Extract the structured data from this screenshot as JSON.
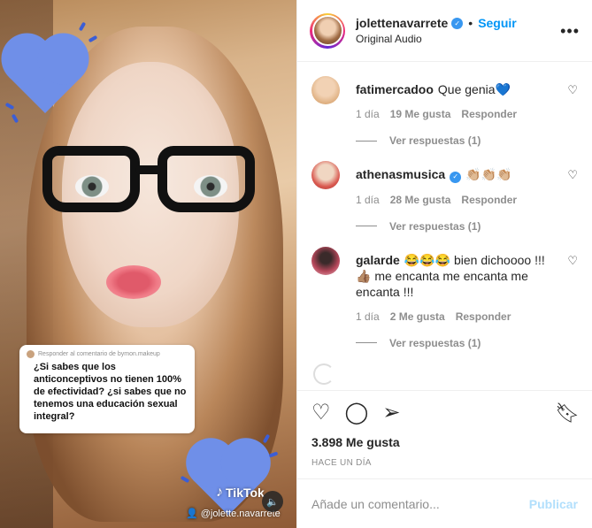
{
  "post": {
    "media": {
      "reply_card": {
        "meta": "Responder al comentario de bymon.makeup",
        "text": "¿Si sabes que los anticonceptivos no tienen 100% de efectividad? ¿si sabes que no tenemos una educación sexual integral?"
      },
      "watermark": "TikTok",
      "handle": "@jolette.navarrete"
    },
    "header": {
      "username": "jolettenavarrete",
      "verified": true,
      "separator": "•",
      "follow_label": "Seguir",
      "subtitle": "Original Audio",
      "more_icon": "more-horizontal-icon"
    },
    "comments": [
      {
        "username": "fatimercadoo",
        "verified": false,
        "text": "Que genia💙",
        "time": "1 día",
        "likes": "19 Me gusta",
        "reply_label": "Responder",
        "view_replies": "Ver respuestas (1)",
        "avatar_color": "#e8c9a8"
      },
      {
        "username": "athenasmusica",
        "verified": true,
        "text": "👏🏼👏🏼👏🏼",
        "time": "1 día",
        "likes": "28 Me gusta",
        "reply_label": "Responder",
        "view_replies": "Ver respuestas (1)",
        "avatar_color": "#d9584f"
      },
      {
        "username": "galarde",
        "verified": false,
        "text": "😂😂😂 bien dichoooo !!! 👍🏽 me encanta me encanta me encanta !!!",
        "time": "1 día",
        "likes": "2 Me gusta",
        "reply_label": "Responder",
        "view_replies": "Ver respuestas (1)",
        "avatar_color": "#b5475a"
      }
    ],
    "actions": {
      "likes": "3.898 Me gusta",
      "time_ago": "HACE UN DÍA",
      "icons": [
        "heart-icon",
        "comment-icon",
        "share-icon",
        "bookmark-icon"
      ]
    },
    "add_comment": {
      "placeholder": "Añade un comentario...",
      "publish_label": "Publicar"
    },
    "colors": {
      "accent": "#0095f6",
      "publish_disabled": "#b2dffc",
      "muted": "#8e8e8e",
      "border": "#efefef",
      "heart_sticker": "#6f8fe8"
    }
  }
}
